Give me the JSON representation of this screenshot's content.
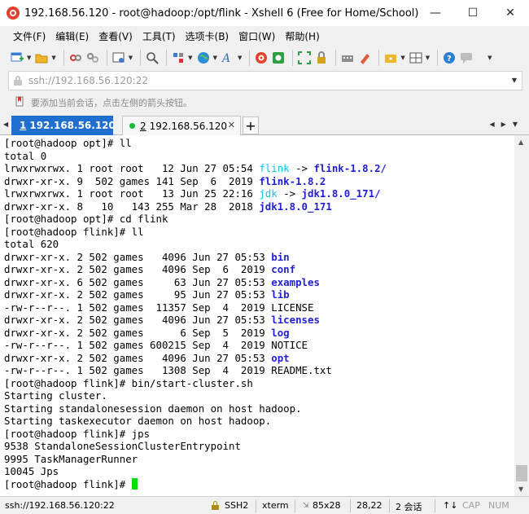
{
  "window": {
    "title": "192.168.56.120 - root@hadoop:/opt/flink - Xshell 6 (Free for Home/School)",
    "minimize": "—",
    "maximize": "☐",
    "close": "✕"
  },
  "menu": [
    "文件(F)",
    "编辑(E)",
    "查看(V)",
    "工具(T)",
    "选项卡(B)",
    "窗口(W)",
    "帮助(H)"
  ],
  "address": {
    "value": "ssh://192.168.56.120:22",
    "dropdown_icon": "chevron-down-icon"
  },
  "hint": {
    "text": "要添加当前会话，点击左侧的箭头按钮。",
    "icon": "bookmark-arrow-icon"
  },
  "tabs": [
    {
      "number": "1",
      "label": "192.168.56.120",
      "active": true,
      "status_color": "#2bd24a"
    },
    {
      "number": "2",
      "label": "192.168.56.120",
      "active": false,
      "status_color": "#18b83a",
      "close": "✕"
    }
  ],
  "tab_add": "+",
  "terminal": {
    "lines": [
      [
        {
          "t": "[root@hadoop opt]# ll"
        }
      ],
      [
        {
          "t": "total 0"
        }
      ],
      [
        {
          "t": "lrwxrwxrwx. 1 root root   12 Jun 27 05:54 "
        },
        {
          "t": "flink",
          "c": "cyan"
        },
        {
          "t": " -> "
        },
        {
          "t": "flink-1.8.2/",
          "c": "blue"
        }
      ],
      [
        {
          "t": "drwxr-xr-x. 9  502 games 141 Sep  6  2019 "
        },
        {
          "t": "flink-1.8.2",
          "c": "blue"
        }
      ],
      [
        {
          "t": "lrwxrwxrwx. 1 root root   13 Jun 25 22:16 "
        },
        {
          "t": "jdk",
          "c": "cyan"
        },
        {
          "t": " -> "
        },
        {
          "t": "jdk1.8.0_171/",
          "c": "blue"
        }
      ],
      [
        {
          "t": "drwxr-xr-x. 8   10   143 255 Mar 28  2018 "
        },
        {
          "t": "jdk1.8.0_171",
          "c": "blue"
        }
      ],
      [
        {
          "t": "[root@hadoop opt]# cd flink"
        }
      ],
      [
        {
          "t": "[root@hadoop flink]# ll"
        }
      ],
      [
        {
          "t": "total 620"
        }
      ],
      [
        {
          "t": "drwxr-xr-x. 2 502 games   4096 Jun 27 05:53 "
        },
        {
          "t": "bin",
          "c": "blue"
        }
      ],
      [
        {
          "t": "drwxr-xr-x. 2 502 games   4096 Sep  6  2019 "
        },
        {
          "t": "conf",
          "c": "blue"
        }
      ],
      [
        {
          "t": "drwxr-xr-x. 6 502 games     63 Jun 27 05:53 "
        },
        {
          "t": "examples",
          "c": "blue"
        }
      ],
      [
        {
          "t": "drwxr-xr-x. 2 502 games     95 Jun 27 05:53 "
        },
        {
          "t": "lib",
          "c": "blue"
        }
      ],
      [
        {
          "t": "-rw-r--r--. 1 502 games  11357 Sep  4  2019 LICENSE"
        }
      ],
      [
        {
          "t": "drwxr-xr-x. 2 502 games   4096 Jun 27 05:53 "
        },
        {
          "t": "licenses",
          "c": "blue"
        }
      ],
      [
        {
          "t": "drwxr-xr-x. 2 502 games      6 Sep  5  2019 "
        },
        {
          "t": "log",
          "c": "blue"
        }
      ],
      [
        {
          "t": "-rw-r--r--. 1 502 games 600215 Sep  4  2019 NOTICE"
        }
      ],
      [
        {
          "t": "drwxr-xr-x. 2 502 games   4096 Jun 27 05:53 "
        },
        {
          "t": "opt",
          "c": "blue"
        }
      ],
      [
        {
          "t": "-rw-r--r--. 1 502 games   1308 Sep  4  2019 README.txt"
        }
      ],
      [
        {
          "t": "[root@hadoop flink]# bin/start-cluster.sh"
        }
      ],
      [
        {
          "t": "Starting cluster."
        }
      ],
      [
        {
          "t": "Starting standalonesession daemon on host hadoop."
        }
      ],
      [
        {
          "t": "Starting taskexecutor daemon on host hadoop."
        }
      ],
      [
        {
          "t": "[root@hadoop flink]# jps"
        }
      ],
      [
        {
          "t": "9538 StandaloneSessionClusterEntrypoint"
        }
      ],
      [
        {
          "t": "9995 TaskManagerRunner"
        }
      ],
      [
        {
          "t": "10045 Jps"
        }
      ],
      [
        {
          "t": "[root@hadoop flink]# "
        }
      ]
    ]
  },
  "status": {
    "host": "ssh://192.168.56.120:22",
    "protocol": "SSH2",
    "term": "xterm",
    "size": "85x28",
    "position": "28,22",
    "sessions": "2 会话",
    "cap": "CAP",
    "num": "NUM"
  }
}
